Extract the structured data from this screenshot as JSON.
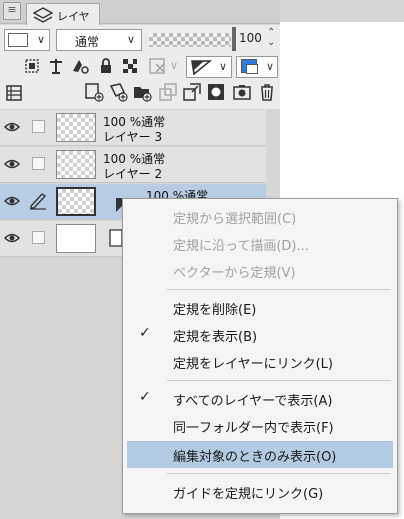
{
  "tabs": {
    "layer_tab_label": "レイヤー"
  },
  "toolbar": {
    "blend_mode": "通常",
    "opacity": "100",
    "opacity_fraction": 0.97
  },
  "layers": [
    {
      "opacity_mode": "100 %通常",
      "name": "レイヤー 3",
      "selected": false
    },
    {
      "opacity_mode": "100 %通常",
      "name": "レイヤー 2",
      "selected": false
    },
    {
      "opacity_mode": "100 %通常",
      "name": "",
      "selected": true
    },
    {
      "opacity_mode": "",
      "name": "",
      "selected": false
    }
  ],
  "context_menu": {
    "items": [
      {
        "label": "定規から選択範囲(C)",
        "enabled": false,
        "checked": false
      },
      {
        "label": "定規に沿って描画(D)...",
        "enabled": false,
        "checked": false
      },
      {
        "label": "ベクターから定規(V)",
        "enabled": false,
        "checked": false
      },
      {
        "label": "定規を削除(E)",
        "enabled": true,
        "checked": false
      },
      {
        "label": "定規を表示(B)",
        "enabled": true,
        "checked": true
      },
      {
        "label": "定規をレイヤーにリンク(L)",
        "enabled": true,
        "checked": false
      },
      {
        "label": "すべてのレイヤーで表示(A)",
        "enabled": true,
        "checked": true
      },
      {
        "label": "同一フォルダー内で表示(F)",
        "enabled": true,
        "checked": false
      },
      {
        "label": "編集対象のときのみ表示(O)",
        "enabled": true,
        "checked": false,
        "highlighted": true
      },
      {
        "label": "ガイドを定規にリンク(G)",
        "enabled": true,
        "checked": false
      }
    ],
    "checkmark": "✓"
  },
  "colors": {
    "highlight": "#b3cbe2",
    "selected_layer": "#b8cde3",
    "panel_bg": "#d6d6d6",
    "accent_blue": "#2f7de1"
  }
}
